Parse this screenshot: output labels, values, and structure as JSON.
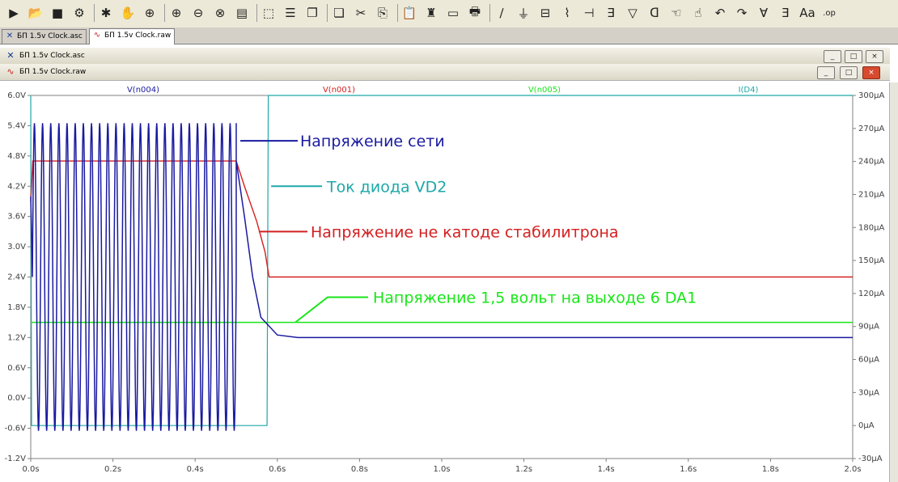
{
  "toolbar": {
    "icons": [
      "run-icon",
      "open-icon",
      "save-icon",
      "control-panel-icon",
      "halt-icon",
      "pan-icon",
      "zoom-in-icon",
      "zoom-area-icon",
      "zoom-out-icon",
      "zoom-cancel-icon",
      "autorange-icon",
      "pick-visible-icon",
      "tile-horizontal-icon",
      "cascade-icon",
      "tile-vertical-icon",
      "cut-icon",
      "copy-icon",
      "paste-icon",
      "find-icon",
      "print-preview-icon",
      "print-icon",
      "wire-icon",
      "ground-icon",
      "label-icon",
      "resistor-icon",
      "capacitor-icon",
      "inductor-icon",
      "diode-icon",
      "component-icon",
      "move-icon",
      "drag-icon",
      "undo-icon",
      "redo-icon",
      "rotate-icon",
      "mirror-icon",
      "text-icon",
      "spice-directive-icon"
    ],
    "glyphs": [
      "▶",
      "📂",
      "■",
      "⚙",
      "✱",
      "✋",
      "⊕",
      "⊕",
      "⊖",
      "⊗",
      "▤",
      "⬚",
      "☰",
      "❐",
      "❏",
      "✂",
      "⎘",
      "📋",
      "♜",
      "▭",
      "🖶",
      "∕",
      "⏚",
      "⊟",
      "⌇",
      "⊣",
      "∃",
      "▽",
      "ᗡ",
      "☜",
      "☝",
      "↶",
      "↷",
      "Ɐ",
      "Ǝ",
      "Aa",
      ".op"
    ]
  },
  "tabs": [
    {
      "label": "БП 1.5v Clock.asc",
      "icon": "schematic-icon"
    },
    {
      "label": "БП 1.5v Clock.raw",
      "icon": "waveform-icon"
    }
  ],
  "windows": {
    "schematic_title": "БП 1.5v Clock.asc",
    "plot_title": "БП 1.5v Clock.raw",
    "min_label": "_",
    "max_label": "□",
    "close_label": "×"
  },
  "chart_data": {
    "type": "line",
    "title": "",
    "x": {
      "label": "",
      "min": 0,
      "max": 2.0,
      "ticks": [
        "0.0s",
        "0.2s",
        "0.4s",
        "0.6s",
        "0.8s",
        "1.0s",
        "1.2s",
        "1.4s",
        "1.6s",
        "1.8s",
        "2.0s"
      ]
    },
    "y_left": {
      "min": -1.2,
      "max": 6.0,
      "step": 0.6,
      "unit": "V",
      "ticks": [
        "6.0V",
        "5.4V",
        "4.8V",
        "4.2V",
        "3.6V",
        "3.0V",
        "2.4V",
        "1.8V",
        "1.2V",
        "0.6V",
        "0.0V",
        "-0.6V",
        "-1.2V"
      ]
    },
    "y_right": {
      "min": -30,
      "max": 300,
      "step": 30,
      "unit": "µA",
      "ticks": [
        "300µA",
        "270µA",
        "240µA",
        "210µA",
        "180µA",
        "150µA",
        "120µA",
        "90µA",
        "60µA",
        "30µA",
        "0µA",
        "-30µA"
      ]
    },
    "grid": false,
    "series": [
      {
        "name": "V(n004)",
        "color": "#1a1aa0",
        "axis": "left",
        "description_points": {
          "oscillation_end": 0.5,
          "amplitude_high": 5.45,
          "amplitude_low": -0.65,
          "cycles": 25,
          "decay_points": [
            [
              0.5,
              4.7
            ],
            [
              0.52,
              3.6
            ],
            [
              0.54,
              2.4
            ],
            [
              0.56,
              1.6
            ],
            [
              0.6,
              1.25
            ],
            [
              0.65,
              1.2
            ],
            [
              2.0,
              1.2
            ]
          ]
        }
      },
      {
        "name": "V(n001)",
        "color": "#d42020",
        "axis": "left",
        "points": [
          [
            0.0,
            4.7
          ],
          [
            0.5,
            4.7
          ],
          [
            0.52,
            4.2
          ],
          [
            0.55,
            3.5
          ],
          [
            0.57,
            2.9
          ],
          [
            0.58,
            2.4
          ],
          [
            2.0,
            2.4
          ]
        ]
      },
      {
        "name": "V(n005)",
        "color": "#19e619",
        "axis": "left",
        "points": [
          [
            0.0,
            1.5
          ],
          [
            2.0,
            1.5
          ]
        ]
      },
      {
        "name": "I(D4)",
        "color": "#1ea8a8",
        "axis": "right",
        "points": [
          [
            0.0,
            0
          ],
          [
            0.575,
            0
          ],
          [
            0.578,
            300
          ],
          [
            2.0,
            300
          ]
        ]
      }
    ],
    "annotations": [
      {
        "text": "Напряжение сети",
        "color": "#1a1aa0"
      },
      {
        "text": "Ток диода VD2",
        "color": "#1ea8a8"
      },
      {
        "text": "Напряжение не катоде стабилитрона",
        "color": "#d42020"
      },
      {
        "text": "Напряжение 1,5 вольт на выходе 6 DA1",
        "color": "#19e619"
      }
    ]
  }
}
